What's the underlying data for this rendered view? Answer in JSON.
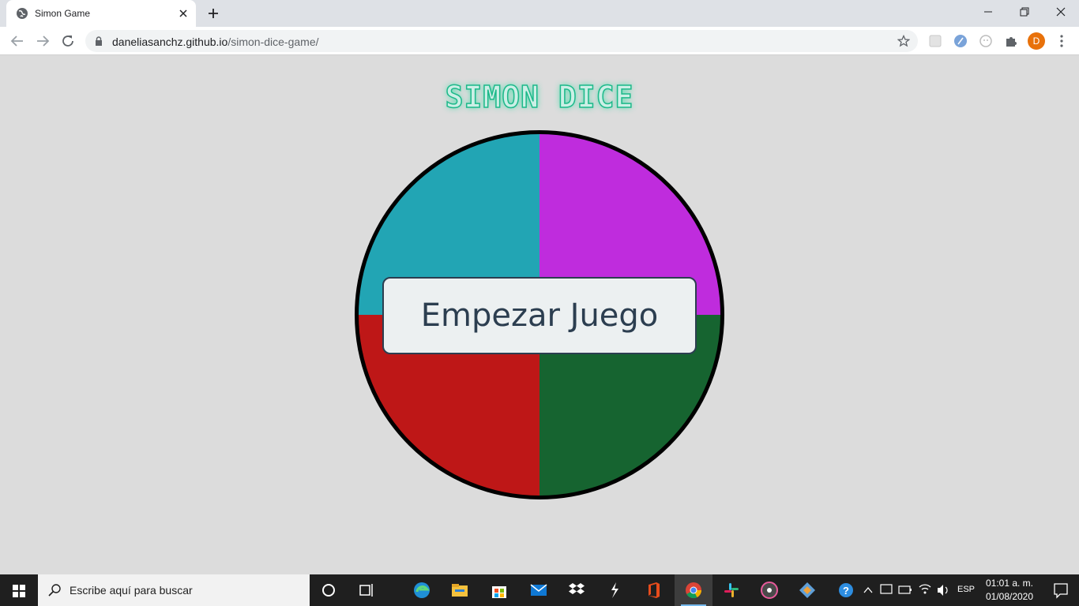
{
  "browser": {
    "tab_title": "Simon Game",
    "url_domain": "daneliasanchz.github.io",
    "url_path": "/simon-dice-game/",
    "profile_initial": "D"
  },
  "game": {
    "title": "SIMON DICE",
    "start_button": "Empezar Juego",
    "colors": {
      "top_left": "#22a5b4",
      "top_right": "#bf2cdd",
      "bottom_left": "#be1717",
      "bottom_right": "#166430"
    }
  },
  "taskbar": {
    "search_placeholder": "Escribe aquí para buscar",
    "language": "ESP",
    "time": "01:01 a. m.",
    "date": "01/08/2020",
    "apps": [
      "edge-icon",
      "file-explorer-icon",
      "store-icon",
      "mail-icon",
      "dropbox-icon",
      "app-icon",
      "office-icon",
      "chrome-icon",
      "slack-icon",
      "media-icon",
      "gitkraken-icon"
    ]
  }
}
